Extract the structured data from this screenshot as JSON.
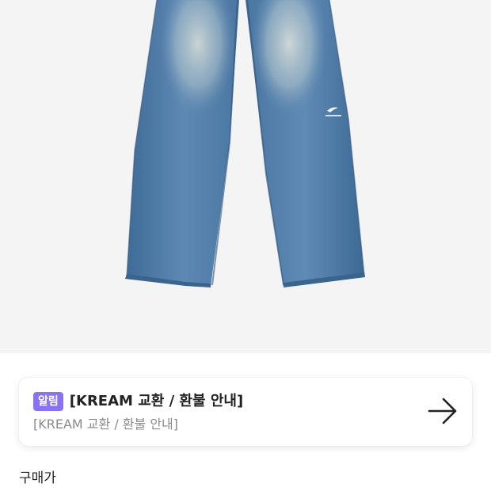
{
  "product": {
    "image_subject": "wide-leg-denim-jeans",
    "background_color": "#f4f4f4"
  },
  "notice": {
    "badge": "알림",
    "badge_color": "#8a72f2",
    "title": "[KREAM 교환 / 환불 안내]",
    "subtitle": "[KREAM 교환 / 환불 안내]",
    "arrow_icon": "arrow-right-icon"
  },
  "price": {
    "label": "구매가"
  }
}
